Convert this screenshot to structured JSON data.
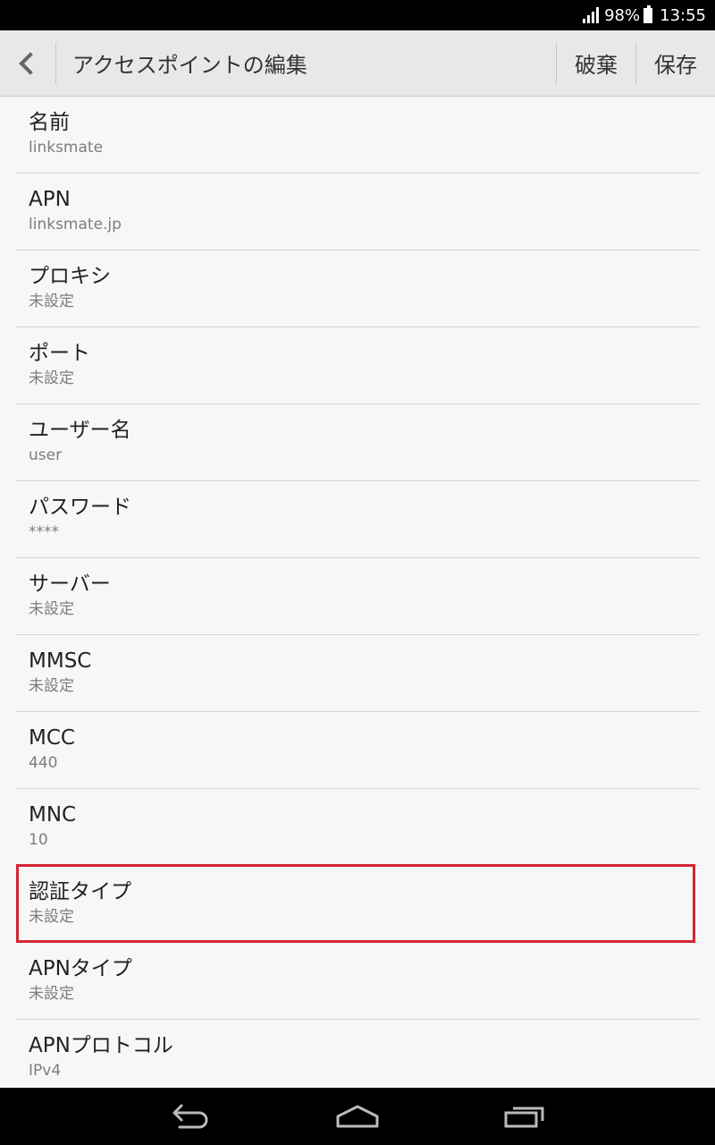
{
  "status_bar": {
    "battery_percent": "98%",
    "time": "13:55"
  },
  "action_bar": {
    "title": "アクセスポイントの編集",
    "discard_label": "破棄",
    "save_label": "保存"
  },
  "settings": [
    {
      "title": "名前",
      "value": "linksmate"
    },
    {
      "title": "APN",
      "value": "linksmate.jp"
    },
    {
      "title": "プロキシ",
      "value": "未設定"
    },
    {
      "title": "ポート",
      "value": "未設定"
    },
    {
      "title": "ユーザー名",
      "value": "user"
    },
    {
      "title": "パスワード",
      "value": "****"
    },
    {
      "title": "サーバー",
      "value": "未設定"
    },
    {
      "title": "MMSC",
      "value": "未設定"
    },
    {
      "title": "MCC",
      "value": "440"
    },
    {
      "title": "MNC",
      "value": "10"
    },
    {
      "title": "認証タイプ",
      "value": "未設定"
    },
    {
      "title": "APNタイプ",
      "value": "未設定"
    },
    {
      "title": "APNプロトコル",
      "value": "IPv4"
    }
  ],
  "colors": {
    "highlight": "#d32632",
    "action_bar_bg": "#e8e8e8",
    "list_bg": "#f7f7f7"
  },
  "icons": {
    "back": "chevron-left-icon",
    "signal": "signal-icon",
    "battery": "battery-icon",
    "nav_back": "back-arrow-icon",
    "nav_home": "home-icon",
    "nav_recents": "recent-apps-icon"
  }
}
